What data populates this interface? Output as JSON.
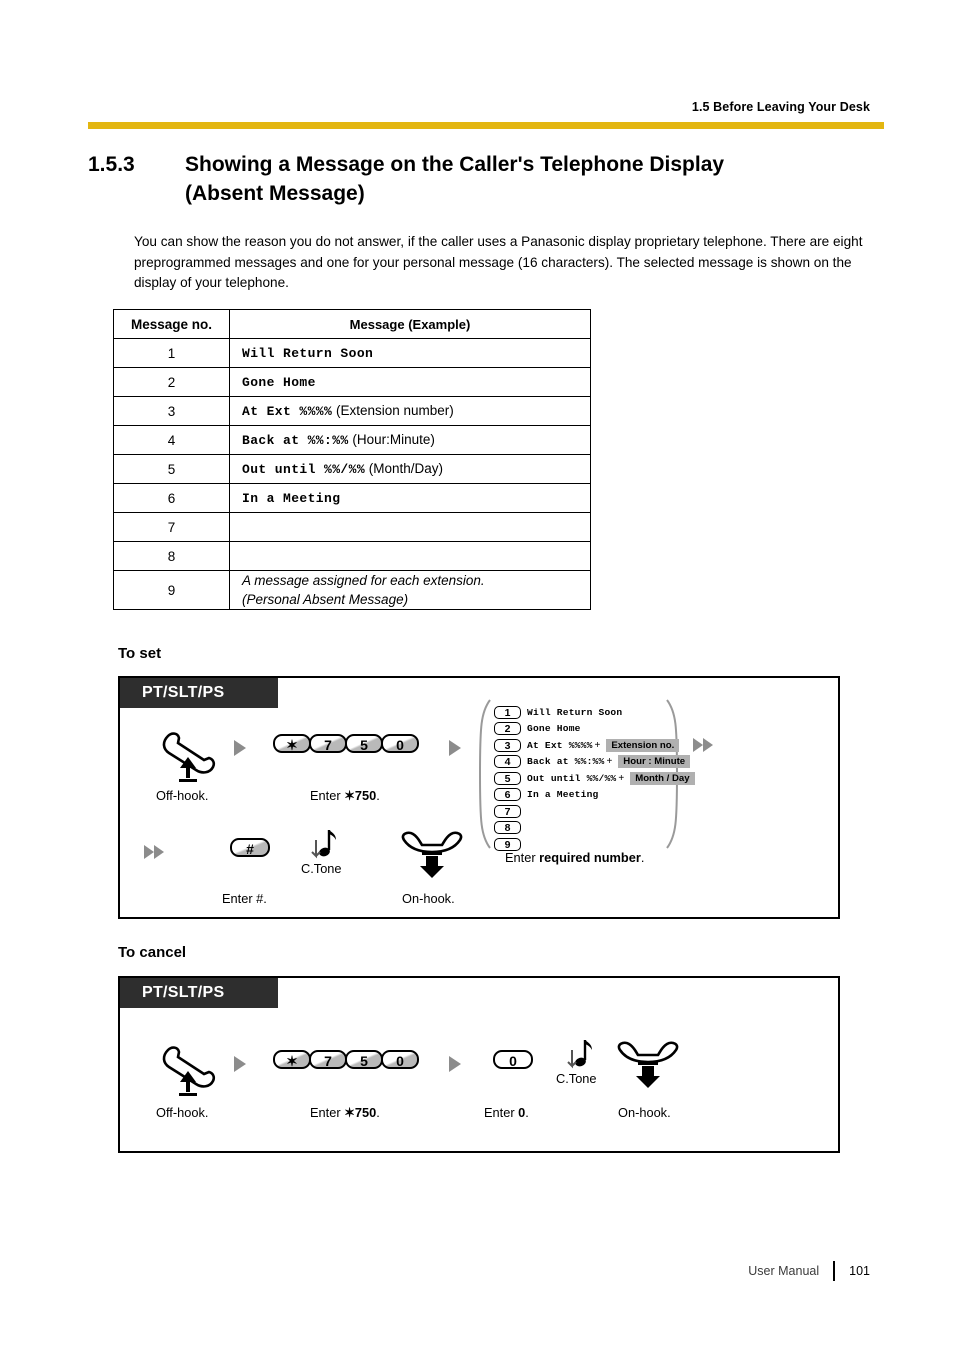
{
  "header": {
    "running_head": "1.5 Before Leaving Your Desk"
  },
  "title": {
    "number": "1.5.3",
    "line1": "Showing a Message on the Caller's Telephone Display",
    "line2": "(Absent Message)"
  },
  "intro": "You can show the reason you do not answer, if the caller uses a Panasonic display proprietary telephone. There are eight preprogrammed messages and one for your personal message (16 characters). The selected message is shown on the display of your telephone.",
  "message_table": {
    "headers": [
      "Message no.",
      "Message (Example)"
    ],
    "rows": [
      {
        "no": "1",
        "mono": "Will Return Soon",
        "note": ""
      },
      {
        "no": "2",
        "mono": "Gone Home",
        "note": ""
      },
      {
        "no": "3",
        "mono": "At Ext %%%%",
        "note": " (Extension number)"
      },
      {
        "no": "4",
        "mono": "Back at %%:%%",
        "note": " (Hour:Minute)"
      },
      {
        "no": "5",
        "mono": "Out until %%/%%",
        "note": " (Month/Day)"
      },
      {
        "no": "6",
        "mono": "In a Meeting",
        "note": ""
      },
      {
        "no": "7",
        "mono": "",
        "note": ""
      },
      {
        "no": "8",
        "mono": "",
        "note": ""
      },
      {
        "no": "9",
        "italic_line1": "A message assigned for each extension.",
        "italic_line2": "(Personal Absent Message)"
      }
    ]
  },
  "to_set": {
    "caption": "To set",
    "phone_tag": "PT/SLT/PS",
    "step_offhook_label": "Off-hook.",
    "keys_750": [
      "✶",
      "7",
      "5",
      "0"
    ],
    "step_750_label_prefix": "Enter ",
    "step_750_label_bold": "✶750",
    "step_750_label_suffix": ".",
    "message_options": [
      {
        "num": "1",
        "text": "Will Return Soon",
        "plus": "",
        "box": ""
      },
      {
        "num": "2",
        "text": "Gone Home",
        "plus": "",
        "box": ""
      },
      {
        "num": "3",
        "text": "At Ext %%%%",
        "plus": "+",
        "box": "Extension no."
      },
      {
        "num": "4",
        "text": "Back at %%:%%",
        "plus": "+",
        "box": "Hour : Minute"
      },
      {
        "num": "5",
        "text": "Out until %%/%%",
        "plus": "+",
        "box": "Month / Day"
      },
      {
        "num": "6",
        "text": "In a Meeting",
        "plus": "",
        "box": ""
      },
      {
        "num": "7",
        "text": "",
        "plus": "",
        "box": ""
      },
      {
        "num": "8",
        "text": "",
        "plus": "",
        "box": ""
      },
      {
        "num": "9",
        "text": "",
        "plus": "",
        "box": ""
      }
    ],
    "required_label_prefix": "Enter ",
    "required_label_bold": "required number",
    "required_label_suffix": ".",
    "hash_key": "#",
    "step_hash_label": "Enter #.",
    "ctone_label": "C.Tone",
    "step_onhook_label": "On-hook."
  },
  "to_cancel": {
    "caption": "To cancel",
    "phone_tag": "PT/SLT/PS",
    "step_offhook_label": "Off-hook.",
    "keys_750": [
      "✶",
      "7",
      "5",
      "0"
    ],
    "step_750_label_prefix": "Enter ",
    "step_750_label_bold": "✶750",
    "step_750_label_suffix": ".",
    "zero_key": "0",
    "step_zero_label_prefix": "Enter ",
    "step_zero_label_bold": "0",
    "step_zero_label_suffix": ".",
    "ctone_label": "C.Tone",
    "step_onhook_label": "On-hook."
  },
  "footer": {
    "manual": "User Manual",
    "page": "101"
  },
  "colors": {
    "rule_gold": "#e3b611",
    "tag_dark": "#2e2e2e",
    "arrow_gray": "#8c8c8c",
    "key_gray": "#b9b9b9",
    "box_gray": "#b0b0b0"
  }
}
